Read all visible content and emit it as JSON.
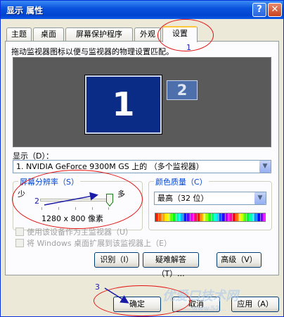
{
  "window": {
    "title": "显示 属性",
    "help_glyph": "?",
    "close_glyph": "✕"
  },
  "tabs": [
    {
      "label": "主题",
      "active": false
    },
    {
      "label": "桌面",
      "active": false
    },
    {
      "label": "屏幕保护程序",
      "active": false
    },
    {
      "label": "外观",
      "active": false
    },
    {
      "label": "设置",
      "active": true
    }
  ],
  "settings": {
    "instruction": "拖动监视器图标以便与监视器的物理设置匹配。",
    "monitor1_label": "1",
    "monitor2_label": "2",
    "display_label": "显示（D）：",
    "display_value": "1. NVIDIA GeForce 9300M GS 上的 （多个监视器）",
    "resolution": {
      "legend": "屏幕分辨率（S）",
      "min_label": "少",
      "max_label": "多",
      "value_text": "1280 x 800 像素",
      "slider_fraction": 1.0
    },
    "color_quality": {
      "legend": "颜色质量（C）",
      "value": "最高（32 位）"
    },
    "checkbox_primary": "使用该设备作为主监视器（U）",
    "checkbox_extend": "将 Windows 桌面扩展到该监视器上（E）",
    "identify_button": "识别（I）",
    "troubleshoot_button": "疑难解答（T）...",
    "advanced_button": "高级（V）"
  },
  "footer": {
    "ok_button": "确定",
    "cancel_button": "取消",
    "apply_button": "应用（A）"
  },
  "annotations": {
    "step1": "1",
    "step2": "2",
    "step3": "3",
    "color": "#e31010"
  },
  "watermark": {
    "text": "优爱口技术网",
    "url": "www.52..."
  }
}
